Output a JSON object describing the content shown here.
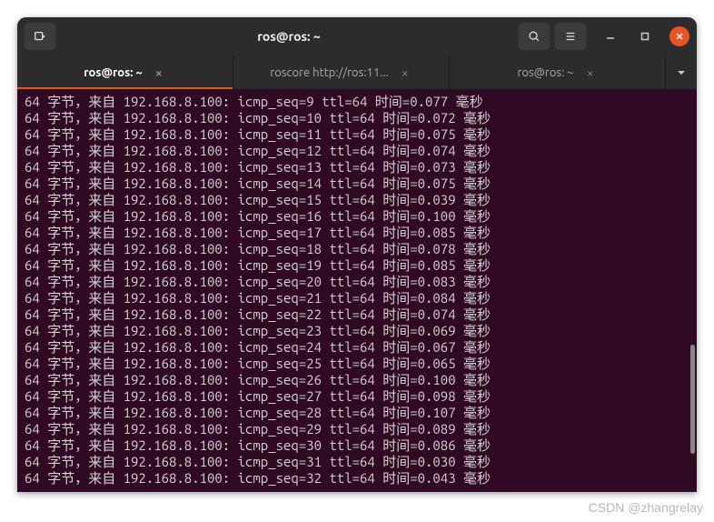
{
  "window": {
    "title": "ros@ros: ~"
  },
  "tabs": [
    {
      "label": "ros@ros: ~",
      "active": true
    },
    {
      "label": "roscore http://ros:11...",
      "active": false
    },
    {
      "label": "ros@ros: ~",
      "active": false
    }
  ],
  "ping": {
    "prefix1": "字节，来自",
    "ip": "192.168.8.100",
    "prefix2": "时间",
    "suffix": "毫秒",
    "lines": [
      {
        "bytes": 64,
        "seq": 9,
        "ttl": 64,
        "time": "0.077"
      },
      {
        "bytes": 64,
        "seq": 10,
        "ttl": 64,
        "time": "0.072"
      },
      {
        "bytes": 64,
        "seq": 11,
        "ttl": 64,
        "time": "0.075"
      },
      {
        "bytes": 64,
        "seq": 12,
        "ttl": 64,
        "time": "0.074"
      },
      {
        "bytes": 64,
        "seq": 13,
        "ttl": 64,
        "time": "0.073"
      },
      {
        "bytes": 64,
        "seq": 14,
        "ttl": 64,
        "time": "0.075"
      },
      {
        "bytes": 64,
        "seq": 15,
        "ttl": 64,
        "time": "0.039"
      },
      {
        "bytes": 64,
        "seq": 16,
        "ttl": 64,
        "time": "0.100"
      },
      {
        "bytes": 64,
        "seq": 17,
        "ttl": 64,
        "time": "0.085"
      },
      {
        "bytes": 64,
        "seq": 18,
        "ttl": 64,
        "time": "0.078"
      },
      {
        "bytes": 64,
        "seq": 19,
        "ttl": 64,
        "time": "0.085"
      },
      {
        "bytes": 64,
        "seq": 20,
        "ttl": 64,
        "time": "0.083"
      },
      {
        "bytes": 64,
        "seq": 21,
        "ttl": 64,
        "time": "0.084"
      },
      {
        "bytes": 64,
        "seq": 22,
        "ttl": 64,
        "time": "0.074"
      },
      {
        "bytes": 64,
        "seq": 23,
        "ttl": 64,
        "time": "0.069"
      },
      {
        "bytes": 64,
        "seq": 24,
        "ttl": 64,
        "time": "0.067"
      },
      {
        "bytes": 64,
        "seq": 25,
        "ttl": 64,
        "time": "0.065"
      },
      {
        "bytes": 64,
        "seq": 26,
        "ttl": 64,
        "time": "0.100"
      },
      {
        "bytes": 64,
        "seq": 27,
        "ttl": 64,
        "time": "0.098"
      },
      {
        "bytes": 64,
        "seq": 28,
        "ttl": 64,
        "time": "0.107"
      },
      {
        "bytes": 64,
        "seq": 29,
        "ttl": 64,
        "time": "0.089"
      },
      {
        "bytes": 64,
        "seq": 30,
        "ttl": 64,
        "time": "0.086"
      },
      {
        "bytes": 64,
        "seq": 31,
        "ttl": 64,
        "time": "0.030"
      },
      {
        "bytes": 64,
        "seq": 32,
        "ttl": 64,
        "time": "0.043"
      }
    ]
  },
  "watermark": "CSDN @zhangrelay"
}
